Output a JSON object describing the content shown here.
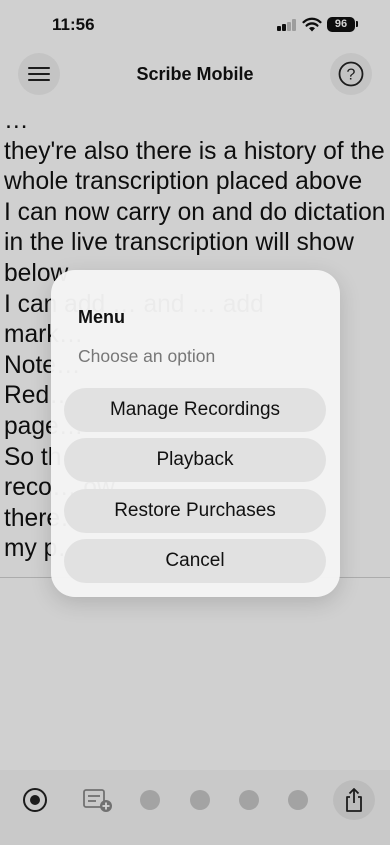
{
  "status_bar": {
    "time": "11:56",
    "battery": "96"
  },
  "nav": {
    "title": "Scribe Mobile",
    "menu_icon": "hamburger-icon",
    "help_icon": "question-mark-icon"
  },
  "transcript": {
    "text": "…\nthey're also there is a history of the\nwhole transcription placed above\nI can now carry on and do dictation\nin the live transcription will show\nbelow\nI can add … and … add\nmark…\nNote…\nRed…\npage…\nSo th… e\nreco… ow\nthere… n to\nmy p…"
  },
  "dialog": {
    "title": "Menu",
    "subtitle": "Choose an option",
    "options": [
      {
        "label": "Manage Recordings"
      },
      {
        "label": "Playback"
      },
      {
        "label": "Restore Purchases"
      },
      {
        "label": "Cancel"
      }
    ]
  },
  "toolbar": {
    "items": [
      "record-icon",
      "new-note-icon",
      "dot",
      "dot",
      "dot",
      "dot",
      "share-icon"
    ]
  },
  "colors": {
    "overlay": "#00000030",
    "dialog_bg": "#f5f5f5",
    "button_bg": "#e1e1e1"
  }
}
